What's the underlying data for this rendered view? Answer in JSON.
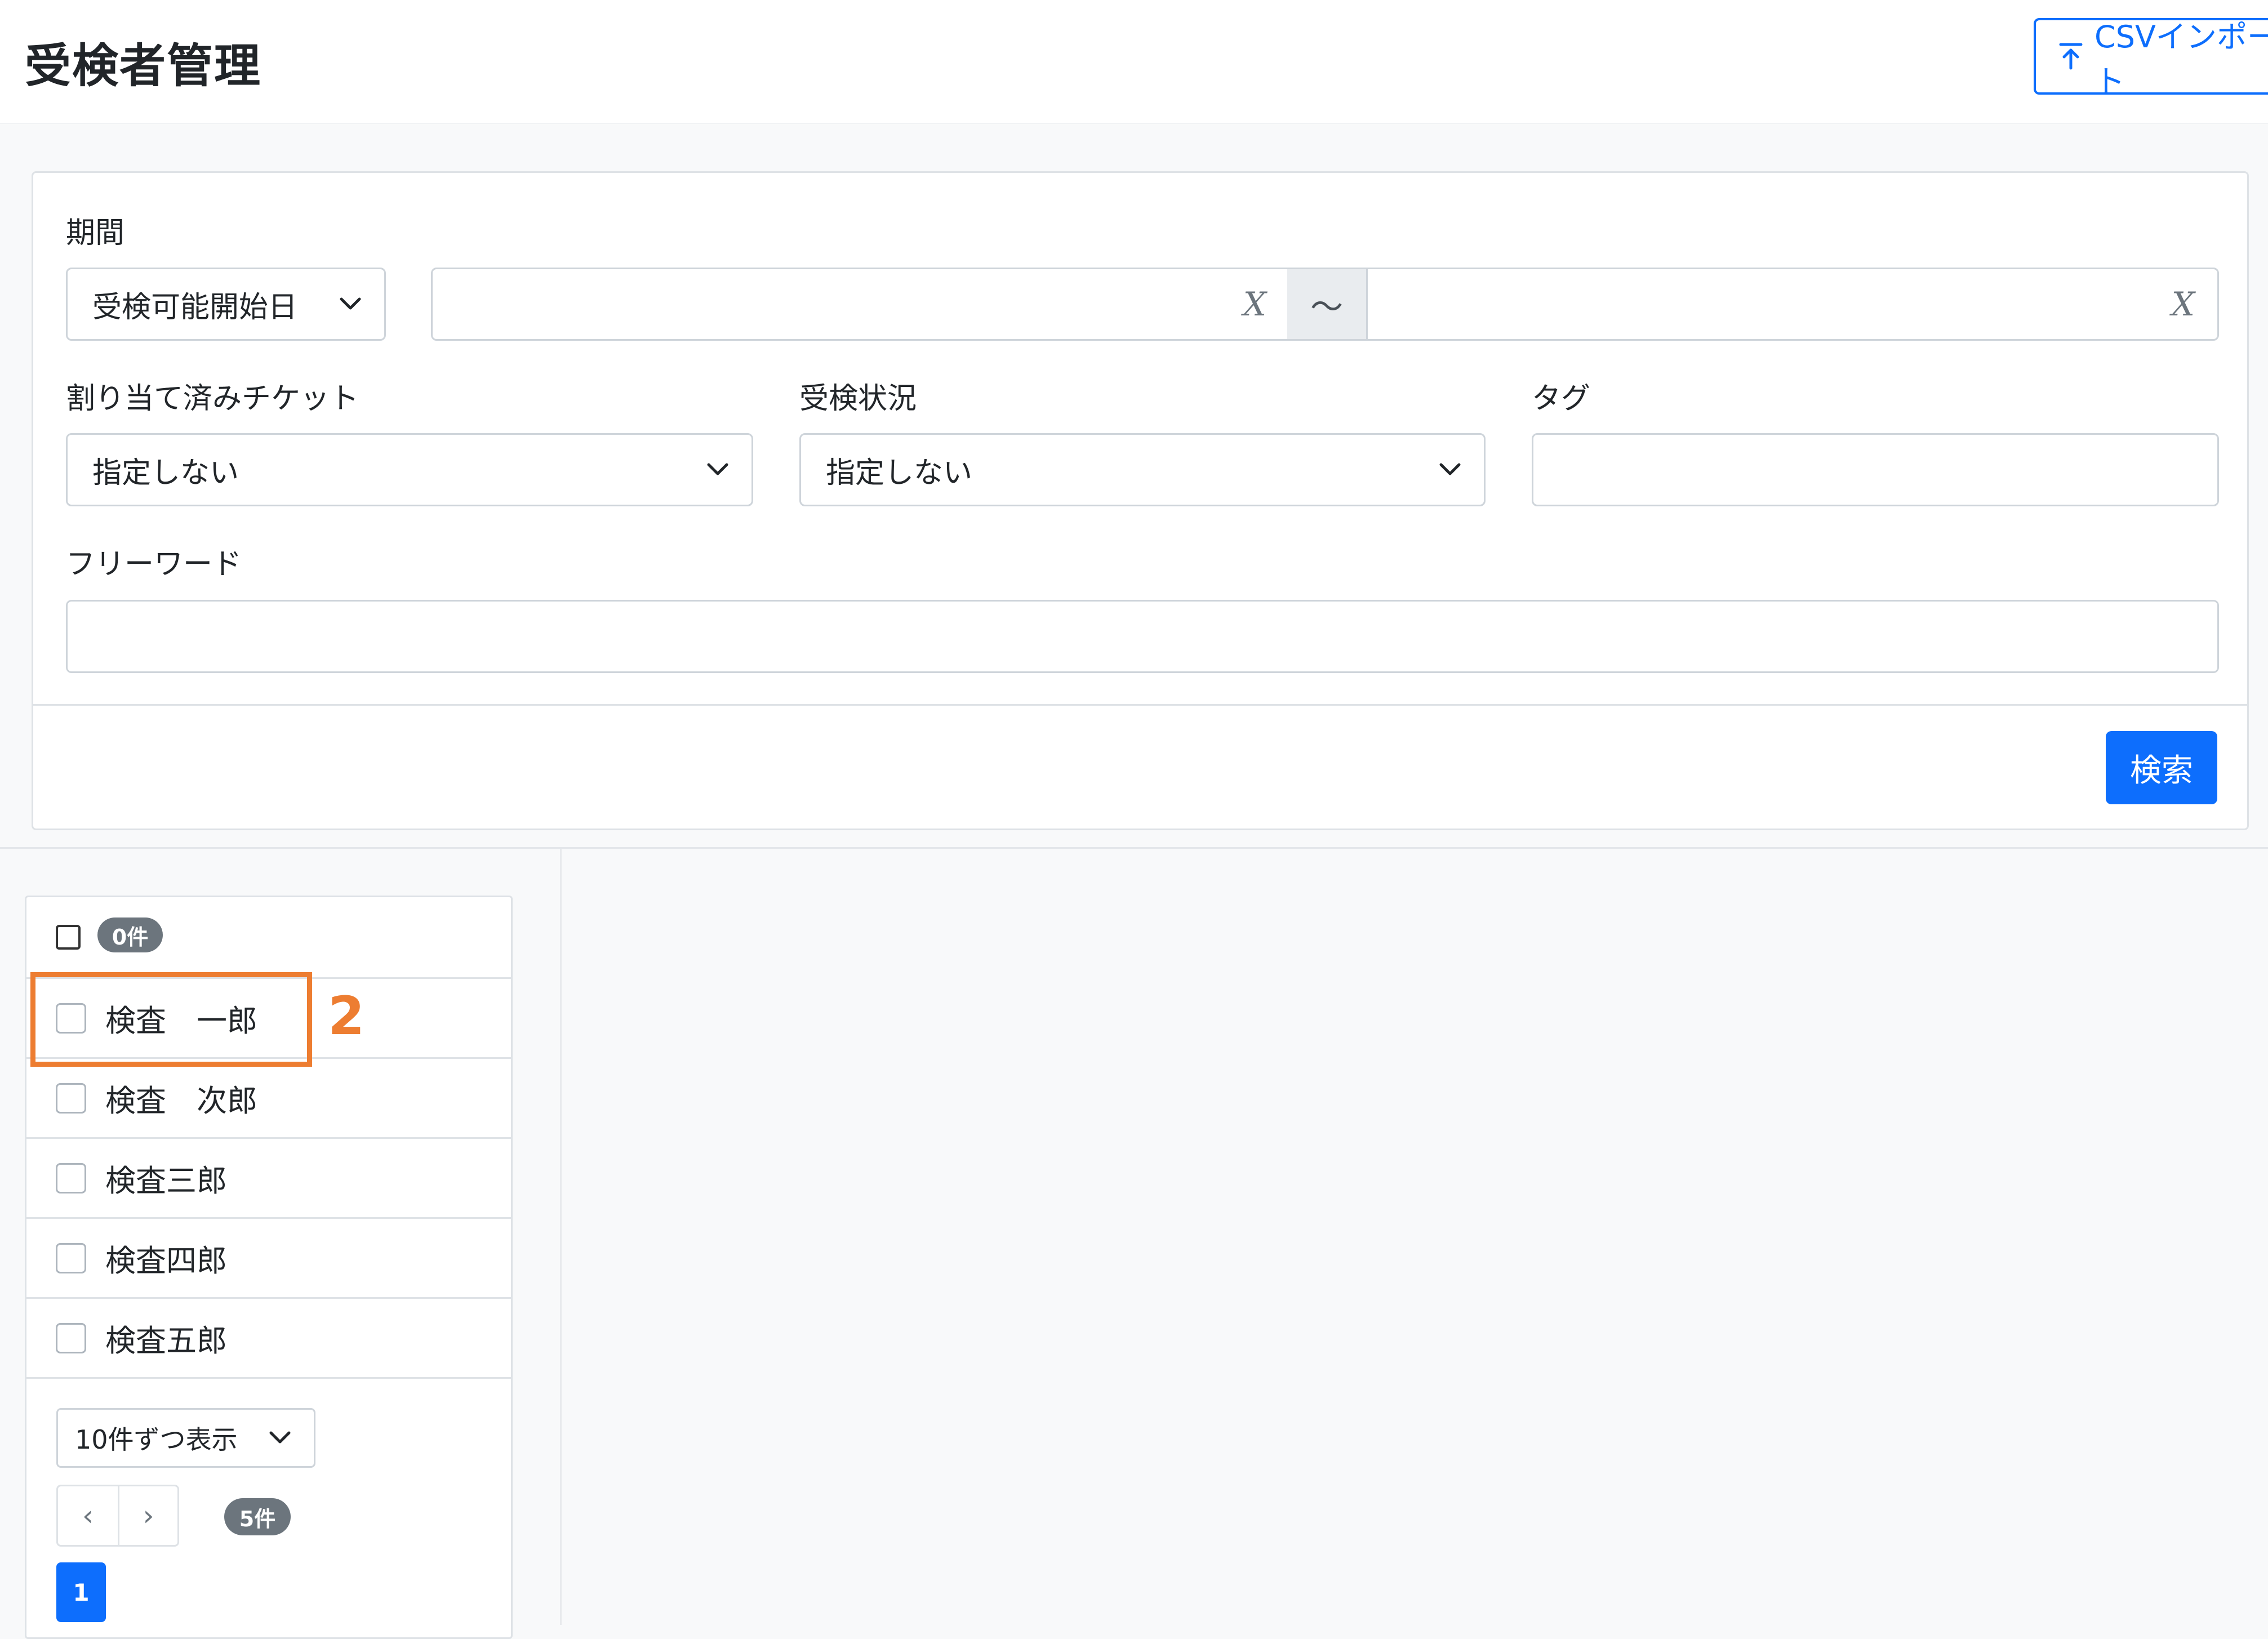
{
  "header": {
    "title": "受検者管理",
    "csv_button_label": "CSVインポート",
    "csv_icon": "upload-icon"
  },
  "filters": {
    "period_label": "期間",
    "period_type_value": "受検可能開始日",
    "range_separator": "〜",
    "clear_glyph": "X",
    "ticket_label": "割り当て済みチケット",
    "ticket_value": "指定しない",
    "status_label": "受検状況",
    "status_value": "指定しない",
    "tag_label": "タグ",
    "tag_value": "",
    "freeword_label": "フリーワード",
    "freeword_value": "",
    "search_button_label": "検索"
  },
  "list": {
    "selected_count_badge": "0件",
    "items": [
      {
        "name": "検査　一郎"
      },
      {
        "name": "検査　次郎"
      },
      {
        "name": "検査三郎"
      },
      {
        "name": "検査四郎"
      },
      {
        "name": "検査五郎"
      }
    ],
    "per_page_value": "10件ずつ表示",
    "prev_label": "‹",
    "next_label": "›",
    "total_badge": "5件",
    "current_page": "1"
  },
  "annotation": {
    "number": "2",
    "color": "#ed7d31"
  },
  "colors": {
    "primary": "#0d6efd",
    "badge": "#6c757d",
    "annotation": "#ed7d31"
  }
}
